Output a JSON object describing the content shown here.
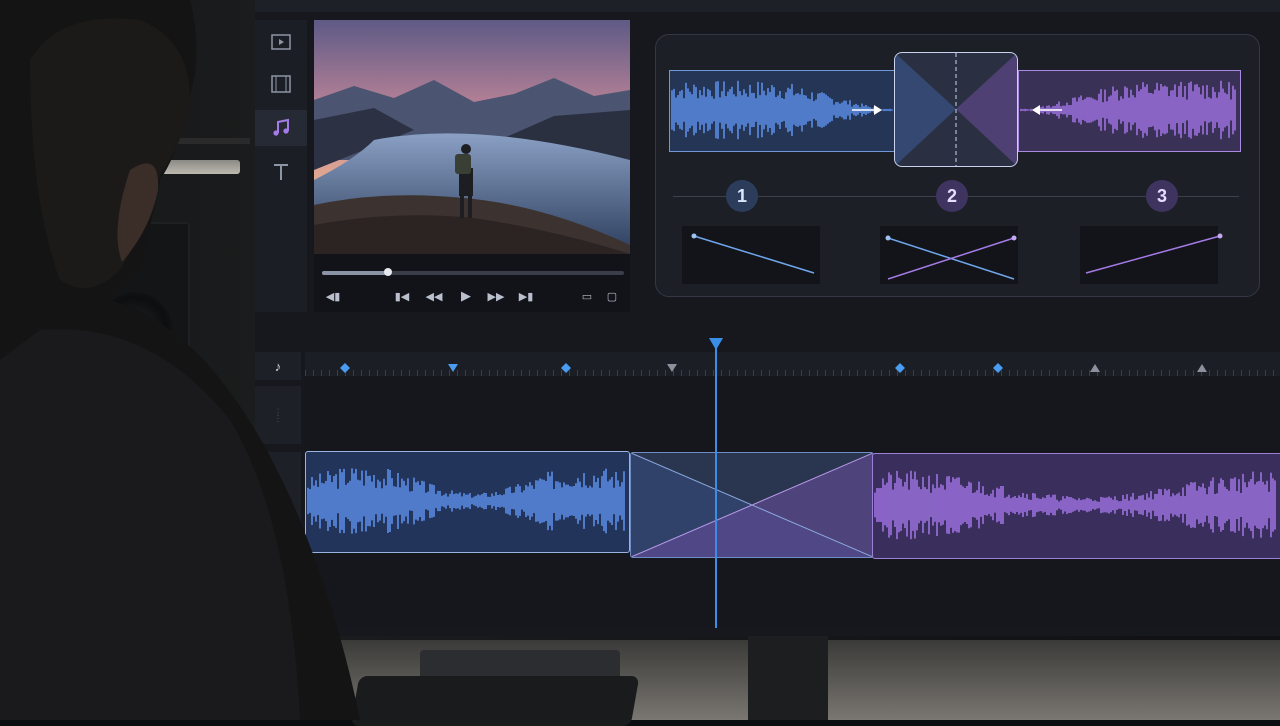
{
  "app": {
    "sidebar": {
      "items": [
        {
          "icon": "video-icon",
          "active": false
        },
        {
          "icon": "film-icon",
          "active": false
        },
        {
          "icon": "music-note-icon",
          "active": true
        },
        {
          "icon": "text-icon",
          "active": false
        }
      ]
    },
    "preview": {
      "scene": "mountain-lake-hiker",
      "progress": 0.22,
      "controls": [
        "volume-icon",
        "skip-back-icon",
        "rewind-icon",
        "play-icon",
        "fast-forward-icon",
        "skip-forward-icon",
        "aspect-icon",
        "fullscreen-icon"
      ]
    },
    "crossfade_diagram": {
      "steps": [
        "1",
        "2",
        "3"
      ],
      "step_colors": [
        "#3b8ee8",
        "#a57be8",
        "#a57be8"
      ],
      "clip_a_color": "#5b8de6",
      "clip_b_color": "#9d72e0",
      "graphs": [
        "fade-out",
        "crossfade",
        "fade-in"
      ]
    },
    "timeline": {
      "playhead_position": 0.42,
      "track1_color": "#5b8de6",
      "track2_color": "#9d72e0",
      "markers": [
        "diamond",
        "triangle-down",
        "diamond",
        "triangle-down-gray",
        "diamond",
        "diamond",
        "triangle-up-gray",
        "triangle-up-gray"
      ]
    }
  }
}
